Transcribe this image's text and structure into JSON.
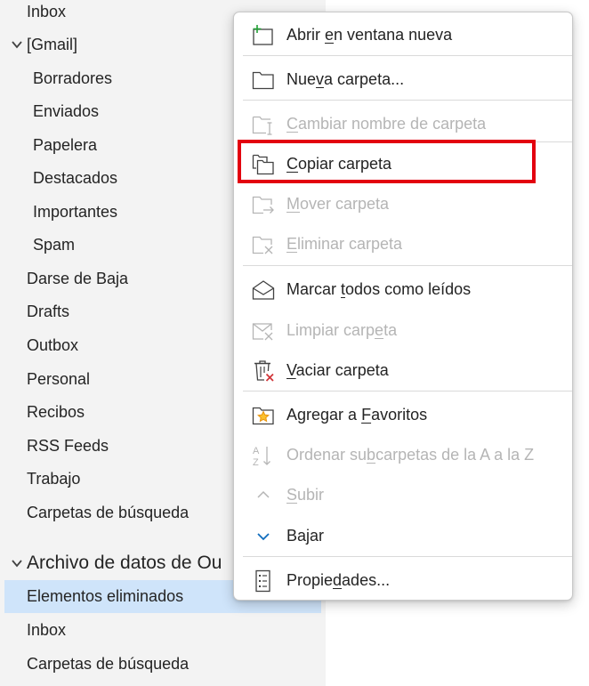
{
  "folder_pane": {
    "items": [
      {
        "label": "Inbox"
      },
      {
        "label": "[Gmail]"
      },
      {
        "label": "Borradores"
      },
      {
        "label": "Enviados"
      },
      {
        "label": "Papelera"
      },
      {
        "label": "Destacados"
      },
      {
        "label": "Importantes"
      },
      {
        "label": "Spam"
      },
      {
        "label": "Darse de Baja"
      },
      {
        "label": "Drafts"
      },
      {
        "label": "Outbox"
      },
      {
        "label": "Personal"
      },
      {
        "label": "Recibos"
      },
      {
        "label": "RSS Feeds"
      },
      {
        "label": "Trabajo"
      },
      {
        "label": "Carpetas de búsqueda"
      },
      {
        "label": "Archivo de datos de Ou"
      },
      {
        "label": "Elementos eliminados"
      },
      {
        "label": "Inbox"
      },
      {
        "label": "Carpetas de búsqueda"
      }
    ]
  },
  "context_menu": {
    "items": [
      {
        "before": "Abrir ",
        "key": "e",
        "after": "n ventana nueva",
        "icon": "new-window-icon",
        "enabled": true
      },
      {
        "before": "Nue",
        "key": "v",
        "after": "a carpeta...",
        "icon": "new-folder-icon",
        "enabled": true
      },
      {
        "before": "",
        "key": "C",
        "after": "ambiar nombre de carpeta",
        "icon": "rename-folder-icon",
        "enabled": false
      },
      {
        "before": "",
        "key": "C",
        "after": "opiar carpeta",
        "icon": "copy-folder-icon",
        "enabled": true
      },
      {
        "before": "",
        "key": "M",
        "after": "over carpeta",
        "icon": "move-folder-icon",
        "enabled": false
      },
      {
        "before": "",
        "key": "E",
        "after": "liminar carpeta",
        "icon": "delete-folder-icon",
        "enabled": false
      },
      {
        "before": "Marcar ",
        "key": "t",
        "after": "odos como leídos",
        "icon": "mark-read-icon",
        "enabled": true
      },
      {
        "before": "Limpiar carp",
        "key": "e",
        "after": "ta",
        "icon": "clean-folder-icon",
        "enabled": false
      },
      {
        "before": "",
        "key": "V",
        "after": "aciar carpeta",
        "icon": "empty-folder-icon",
        "enabled": true
      },
      {
        "before": "Agregar a ",
        "key": "F",
        "after": "avoritos",
        "icon": "favorites-icon",
        "enabled": true
      },
      {
        "before": "Ordenar su",
        "key": "b",
        "after": "carpetas de la A a la Z",
        "icon": "sort-az-icon",
        "enabled": false
      },
      {
        "before": "",
        "key": "S",
        "after": "ubir",
        "icon": "chevron-up-icon",
        "enabled": false
      },
      {
        "before": "Bajar",
        "key": "",
        "after": "",
        "icon": "chevron-down-icon",
        "enabled": true
      },
      {
        "before": "Propie",
        "key": "d",
        "after": "ades...",
        "icon": "properties-icon",
        "enabled": true
      }
    ]
  },
  "colors": {
    "highlight": "#e3000f",
    "selected_row": "#cfe4fa",
    "pane_background": "#f3f3f3",
    "disabled_text": "#b5b5b5",
    "accent_green": "#22a036",
    "accent_red": "#d13438",
    "accent_orange": "#e8930c",
    "accent_blue": "#0f6cbd"
  }
}
